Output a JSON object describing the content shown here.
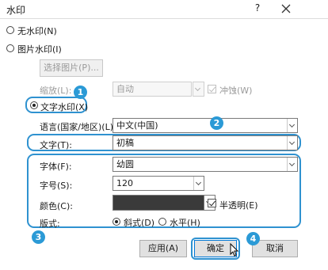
{
  "dialog": {
    "title": "水印",
    "help": "?",
    "close_icon": "close-icon"
  },
  "options": {
    "no_watermark": "无水印(N)",
    "picture_watermark": "图片水印(I)",
    "select_picture": "选择图片(P)...",
    "scale_label": "缩放(L):",
    "scale_value": "自动",
    "washout": "冲蚀(W)",
    "text_watermark": "文字水印(X)"
  },
  "text_form": {
    "language_label": "语言(国家/地区)(L):",
    "language_value": "中文(中国)",
    "text_label": "文字(T):",
    "text_value": "初稿",
    "font_label": "字体(F):",
    "font_value": "幼圆",
    "size_label": "字号(S):",
    "size_value": "120",
    "color_label": "颜色(C):",
    "color_value": "#3a3a3a",
    "semi_transparent": "半透明(E)",
    "layout_label": "版式:",
    "layout_diagonal": "斜式(D)",
    "layout_horizontal": "水平(H)"
  },
  "buttons": {
    "apply": "应用(A)",
    "ok": "确定",
    "cancel": "取消"
  },
  "badges": [
    "1",
    "2",
    "3",
    "4"
  ],
  "accent": "#2f92d0"
}
